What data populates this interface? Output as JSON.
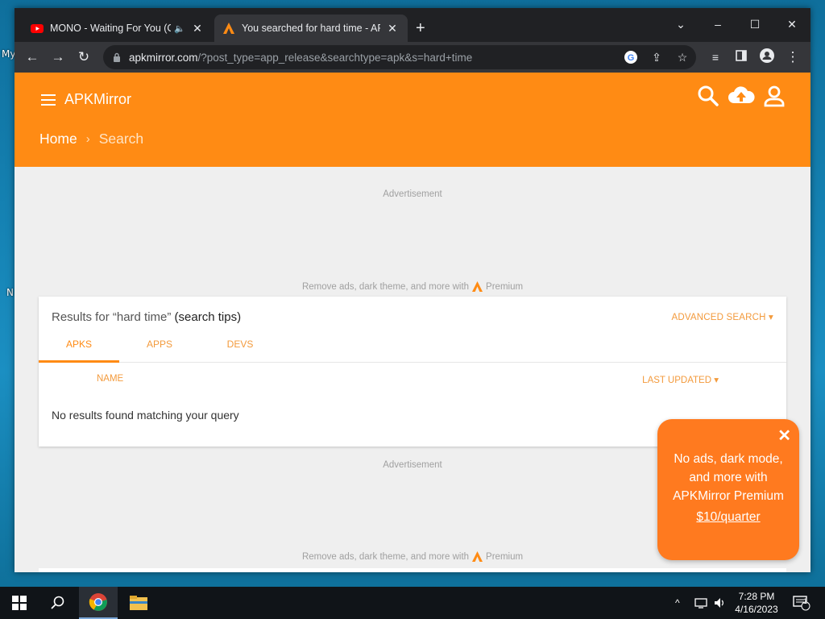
{
  "desktop": {
    "labels": [
      "My",
      "N"
    ]
  },
  "browser": {
    "tabs": [
      {
        "title": "MONO - Waiting For You (Of",
        "audio_icon": "speaker-icon",
        "favicon": "youtube-icon"
      },
      {
        "title": "You searched for hard time - APK",
        "favicon": "apkmirror-icon"
      }
    ],
    "new_tab_label": "+",
    "window_controls": {
      "minimize": "–",
      "maximize": "☐",
      "close": "✕"
    },
    "address": {
      "domain": "apkmirror.com",
      "path": "/?post_type=app_release&searchtype=apk&s=hard+time"
    }
  },
  "site": {
    "name": "APKMirror",
    "brand_color": "#ff8b14",
    "breadcrumb": {
      "home": "Home",
      "separator": "›",
      "current": "Search"
    },
    "ad_label": "Advertisement",
    "premium_line": {
      "prefix": "Remove ads, dark theme, and more with",
      "suffix": "Premium"
    },
    "results": {
      "title_prefix": "Results for “hard time”",
      "tips_label": "(search tips)",
      "advanced_search": "ADVANCED SEARCH ▾",
      "tabs": [
        "APKS",
        "APPS",
        "DEVS"
      ],
      "active_tab": "APKS",
      "col_name": "NAME",
      "col_updated": "LAST UPDATED ▾",
      "empty_message": "No results found matching your query"
    },
    "promo": {
      "close": "✕",
      "text": "No ads, dark mode, and more with APKMirror Premium",
      "price": "$10/quarter",
      "color": "#ff7a1f"
    }
  },
  "taskbar": {
    "clock_time": "7:28 PM",
    "clock_date": "4/16/2023",
    "notification_count": "1",
    "tray_chevron": "^"
  }
}
